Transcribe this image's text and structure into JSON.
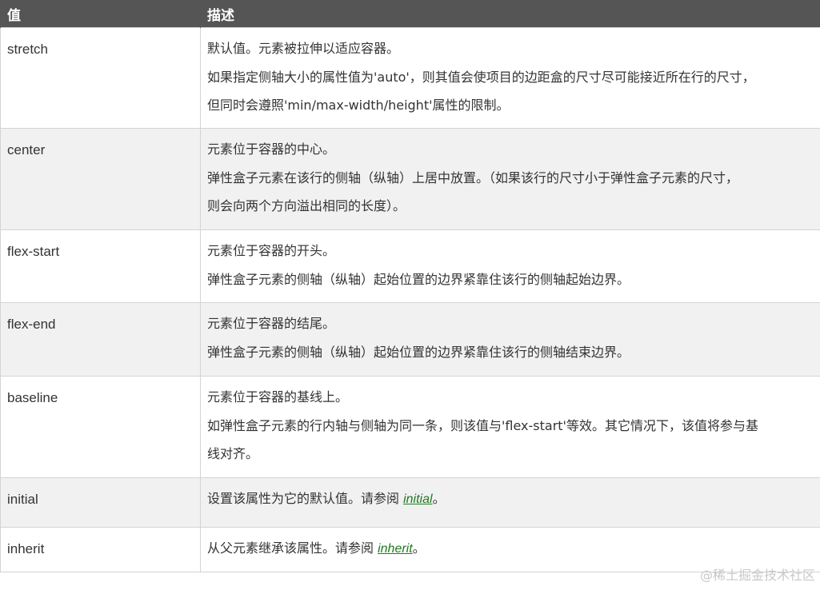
{
  "table": {
    "headers": [
      "值",
      "描述"
    ],
    "rows": [
      {
        "value": "stretch",
        "lines": [
          "默认值。元素被拉伸以适应容器。",
          "如果指定侧轴大小的属性值为'auto'，则其值会使项目的边距盒的尺寸尽可能接近所在行的尺寸，",
          "但同时会遵照'min/max-width/height'属性的限制。"
        ]
      },
      {
        "value": "center",
        "lines": [
          "元素位于容器的中心。",
          "弹性盒子元素在该行的侧轴（纵轴）上居中放置。（如果该行的尺寸小于弹性盒子元素的尺寸，",
          "则会向两个方向溢出相同的长度）。"
        ]
      },
      {
        "value": "flex-start",
        "lines": [
          "元素位于容器的开头。",
          "弹性盒子元素的侧轴（纵轴）起始位置的边界紧靠住该行的侧轴起始边界。"
        ]
      },
      {
        "value": "flex-end",
        "lines": [
          "元素位于容器的结尾。",
          "弹性盒子元素的侧轴（纵轴）起始位置的边界紧靠住该行的侧轴结束边界。"
        ]
      },
      {
        "value": "baseline",
        "lines": [
          "元素位于容器的基线上。",
          "如弹性盒子元素的行内轴与侧轴为同一条，则该值与'flex-start'等效。其它情况下，该值将参与基",
          "线对齐。"
        ]
      },
      {
        "value": "initial",
        "text_before": "设置该属性为它的默认值。请参阅 ",
        "link": "initial",
        "text_after": "。"
      },
      {
        "value": "inherit",
        "text_before": "从父元素继承该属性。请参阅 ",
        "link": "inherit",
        "text_after": "。"
      }
    ]
  },
  "watermark": "@稀土掘金技术社区",
  "colors": {
    "header_bg": "#555555",
    "row_alt_bg": "#f1f1f1",
    "link": "#1e7b1e",
    "border": "#d4d4d4"
  }
}
